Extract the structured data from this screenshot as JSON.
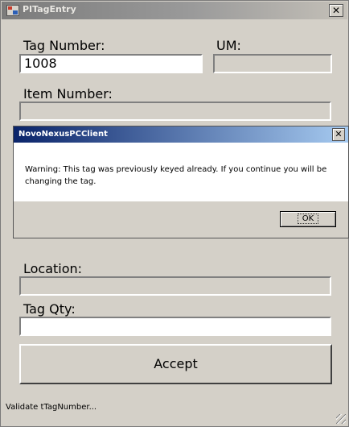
{
  "window": {
    "title": "PITagEntry",
    "close_glyph": "✕"
  },
  "form": {
    "tag_number_label": "Tag Number:",
    "tag_number_value": "1008",
    "um_label": "UM:",
    "um_value": "",
    "item_number_label": "Item Number:",
    "item_number_value": "",
    "location_label": "Location:",
    "location_value": "",
    "tag_qty_label": "Tag Qty:",
    "tag_qty_value": "",
    "accept_label": "Accept"
  },
  "dialog": {
    "title": "NovoNexusPCClient",
    "close_glyph": "✕",
    "message": "Warning: This tag was previously keyed already.  If you continue you will be changing the tag.",
    "ok_label": "OK"
  },
  "status": {
    "text": "Validate tTagNumber..."
  }
}
